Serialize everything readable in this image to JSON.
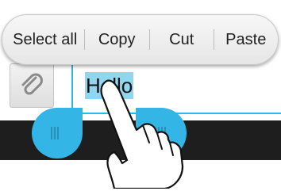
{
  "action_bar": {
    "select_all_label": "Select all",
    "copy_label": "Copy",
    "cut_label": "Cut",
    "paste_label": "Paste"
  },
  "compose": {
    "attach_icon": "paperclip-icon",
    "text_value": "Hello"
  },
  "colors": {
    "accent": "#33b5e5",
    "selection_highlight": "#33b5e5",
    "handle": "#33b5e5",
    "bottom_strip": "#1e1e1e"
  },
  "icons": {
    "selection_handles": "text-selection-handle-icon",
    "gesture": "pointing-finger-icon"
  }
}
